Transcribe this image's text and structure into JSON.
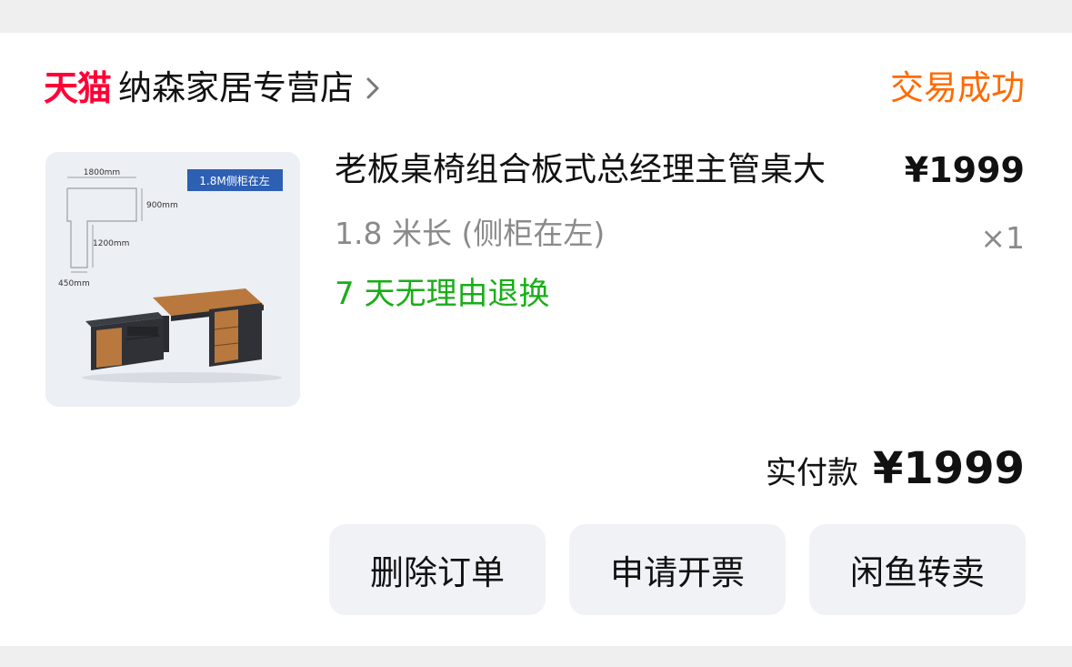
{
  "store": {
    "platform_logo": "天猫",
    "name": "纳森家居专营店",
    "order_status": "交易成功"
  },
  "product": {
    "title": "老板桌椅组合板式总经理主管桌大",
    "price": "¥1999",
    "variant": "1.8 米长 (侧柜在左)",
    "quantity": "×1",
    "service_tag": "7 天无理由退换",
    "image_labels": {
      "badge": "1.8M侧柜在左",
      "width": "1800mm",
      "depth": "900mm",
      "return_length": "1200mm",
      "return_width": "450mm"
    }
  },
  "payment": {
    "label": "实付款",
    "amount": "¥1999"
  },
  "actions": {
    "delete_order": "删除订单",
    "request_invoice": "申请开票",
    "resell_xianyu": "闲鱼转卖"
  },
  "colors": {
    "tmall_red": "#ff0036",
    "status_orange": "#ff6a00",
    "service_green": "#1aad19",
    "button_bg": "#f1f2f6"
  },
  "icons": {
    "store_chevron": "chevron-right-icon"
  }
}
